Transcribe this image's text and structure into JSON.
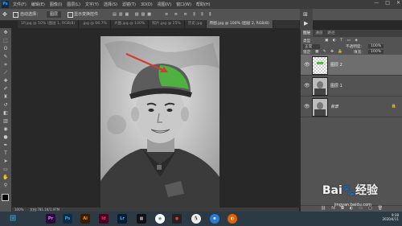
{
  "app": {
    "logo": "Ps"
  },
  "menu": [
    "文件(F)",
    "编辑(E)",
    "图像(I)",
    "图层(L)",
    "文字(Y)",
    "选择(S)",
    "滤镜(T)",
    "3D(D)",
    "视图(V)",
    "窗口(W)",
    "帮助(H)"
  ],
  "window_controls": [
    "—",
    "□",
    "✕"
  ],
  "options": {
    "auto_select_label": "自动选择：",
    "auto_select_value": "图层",
    "transform_label": "显示变换控件"
  },
  "doc_tabs": [
    {
      "label": "1P.jpg @ 50% (图层 1, RGB/8)"
    },
    {
      "label": ".jpg @ 66.7%"
    },
    {
      "label": "大图.jpg @ 100%"
    },
    {
      "label": "照片.jpg @ 25%"
    },
    {
      "label": "历史.jpg"
    },
    {
      "label": "原图.jpg @ 100% (图层 2, RGB/8)",
      "active": true
    }
  ],
  "statusbar": {
    "zoom": "100%",
    "doc": "文档:781.1K/1.97M"
  },
  "panels": {
    "tabs": [
      "图层",
      "通道",
      "路径"
    ],
    "kind_label": "类型",
    "blend_mode": "正常",
    "opacity_label": "不透明度:",
    "opacity_value": "100%",
    "lock_label": "锁定:",
    "fill_label": "填充:",
    "fill_value": "100%",
    "layers": [
      {
        "name": "图层 2",
        "selected": true
      },
      {
        "name": "图层 1",
        "selected": false
      },
      {
        "name": "背景",
        "selected": false,
        "locked": true
      }
    ]
  },
  "watermark": {
    "brand": "Bai",
    "brand_cn": "经验",
    "url": "jingyan.baidu.com"
  },
  "clock": {
    "time": "9:38",
    "date": "2020/4/11"
  },
  "taskbar_icons": [
    "windows-icon",
    "premiere-icon",
    "photoshop-icon",
    "illustrator-icon",
    "indesign-icon",
    "lightroom-icon",
    "media-icon",
    "chrome-icon",
    "qq-icon",
    "browser-icon",
    "firefox-icon"
  ],
  "colors": {
    "accent": "#31a8ff",
    "arrow": "#d63a2f",
    "hat_highlight": "#4bbf3b"
  }
}
